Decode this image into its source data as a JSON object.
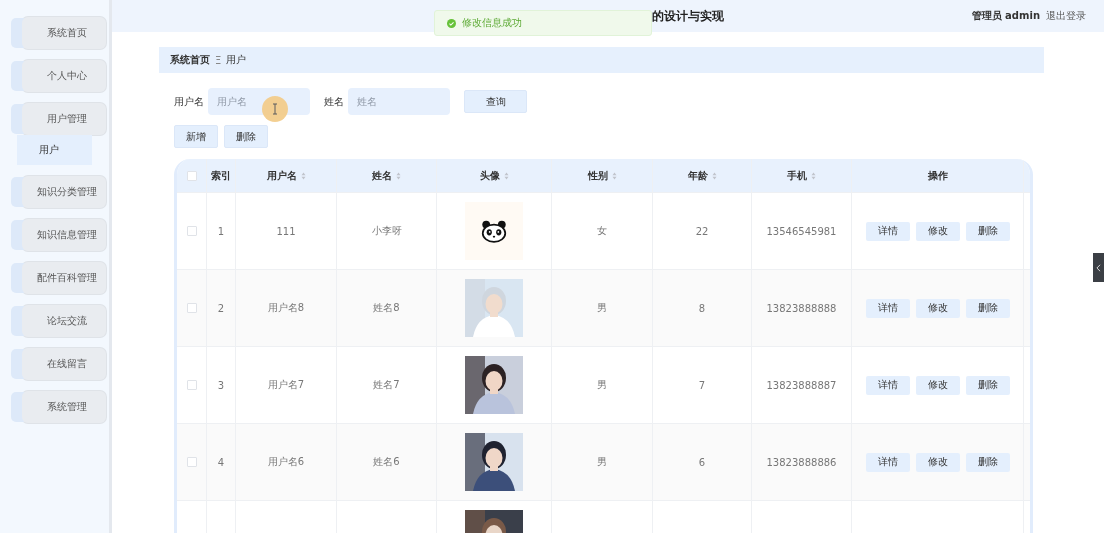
{
  "sidebar": {
    "items": [
      {
        "label": "系统首页"
      },
      {
        "label": "个人中心"
      },
      {
        "label": "用户管理",
        "children": [
          {
            "label": "用户",
            "selected": true
          }
        ]
      },
      {
        "label": "知识分类管理"
      },
      {
        "label": "知识信息管理"
      },
      {
        "label": "配件百科管理"
      },
      {
        "label": "论坛交流"
      },
      {
        "label": "在线留言"
      },
      {
        "label": "系统管理"
      }
    ]
  },
  "header": {
    "title": "的设计与实现",
    "role": "管理员",
    "user": "admin",
    "logout": "退出登录"
  },
  "toast": {
    "message": "修改信息成功"
  },
  "breadcrumb": {
    "home": "系统首页",
    "separator": "Ξ",
    "current": "用户"
  },
  "search": {
    "fields": [
      {
        "label": "用户名",
        "placeholder": "用户名"
      },
      {
        "label": "姓名",
        "placeholder": "姓名"
      }
    ],
    "button": "查询"
  },
  "actions": [
    "新增",
    "删除"
  ],
  "table": {
    "columns": [
      {
        "kind": "check"
      },
      {
        "label": "索引",
        "kind": "plain"
      },
      {
        "label": "用户名",
        "kind": "sort"
      },
      {
        "label": "姓名",
        "kind": "sort"
      },
      {
        "label": "头像",
        "kind": "sort"
      },
      {
        "label": "性别",
        "kind": "sort"
      },
      {
        "label": "年龄",
        "kind": "sort"
      },
      {
        "label": "手机",
        "kind": "sort"
      },
      {
        "label": "操作",
        "kind": "plain"
      }
    ],
    "header_checked": false,
    "rows": [
      {
        "kind": "icon_avatar",
        "checked": false,
        "index": "1",
        "username": "111",
        "name": "小李呀",
        "gender": "女",
        "age": "22",
        "phone": "13546545981",
        "actions": [
          "详情",
          "修改",
          "删除"
        ]
      },
      {
        "kind": "photo_avatar",
        "checked": false,
        "index": "2",
        "username": "用户名8",
        "name": "姓名8",
        "gender": "男",
        "age": "8",
        "phone": "13823888888",
        "actions": [
          "详情",
          "修改",
          "删除"
        ]
      },
      {
        "kind": "photo_avatar",
        "checked": false,
        "index": "3",
        "username": "用户名7",
        "name": "姓名7",
        "gender": "男",
        "age": "7",
        "phone": "13823888887",
        "actions": [
          "详情",
          "修改",
          "删除"
        ]
      },
      {
        "kind": "photo_avatar",
        "checked": false,
        "index": "4",
        "username": "用户名6",
        "name": "姓名6",
        "gender": "男",
        "age": "6",
        "phone": "13823888886",
        "actions": [
          "详情",
          "修改",
          "删除"
        ]
      },
      {
        "kind": "cut_off"
      }
    ]
  }
}
